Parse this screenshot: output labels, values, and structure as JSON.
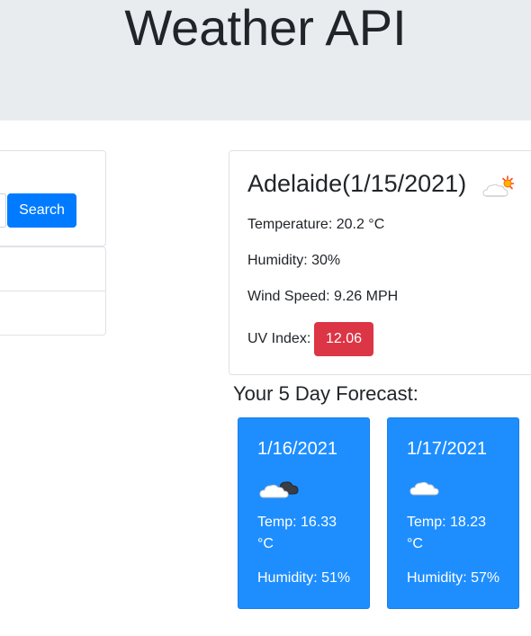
{
  "header": {
    "title": "Weather API"
  },
  "search": {
    "button_label": "Search"
  },
  "history": {
    "items": [
      "",
      ""
    ]
  },
  "current": {
    "city_date": "Adelaide(1/15/2021)",
    "icon": "partly-sunny-cloud-icon",
    "temperature": "Temperature: 20.2 °C",
    "humidity": "Humidity: 30%",
    "wind": "Wind Speed: 9.26 MPH",
    "uv_label": "UV Index:",
    "uv_value": "12.06",
    "uv_color": "#dc3545"
  },
  "forecast": {
    "heading": "Your 5 Day Forecast:",
    "card_color": "#1e8eff",
    "days": [
      {
        "date": "1/16/2021",
        "icon": "cloud-dark-icon",
        "temp": "Temp: 16.33 °C",
        "humidity": "Humidity: 51%"
      },
      {
        "date": "1/17/2021",
        "icon": "cloud-icon",
        "temp": "Temp: 18.23 °C",
        "humidity": "Humidity: 57%"
      }
    ]
  }
}
